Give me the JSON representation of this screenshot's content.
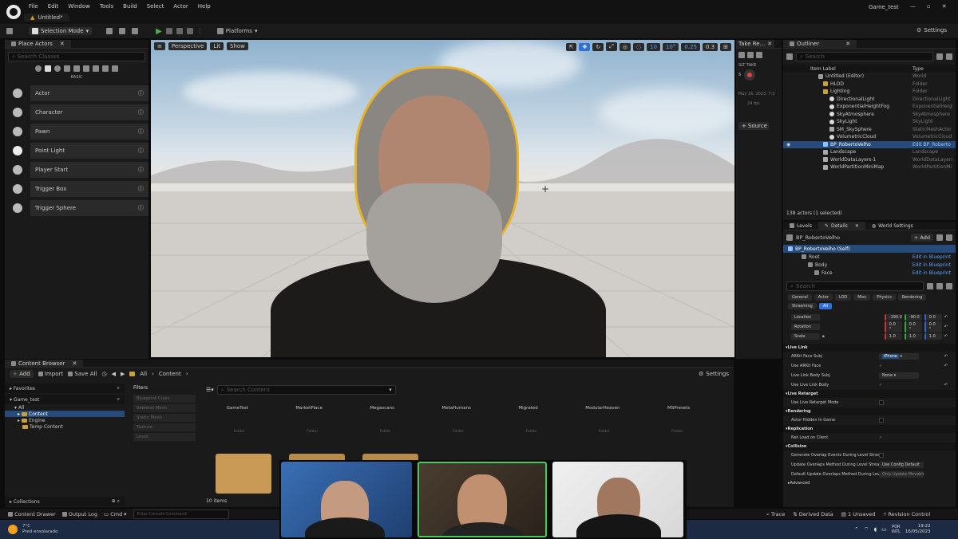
{
  "menubar": {
    "items": [
      "File",
      "Edit",
      "Window",
      "Tools",
      "Build",
      "Select",
      "Actor",
      "Help"
    ],
    "project": "Game_test",
    "level_tab": "Untitled*"
  },
  "toolbar": {
    "selection_mode": "Selection Mode",
    "platforms": "Platforms",
    "settings": "Settings"
  },
  "place_actors": {
    "tab": "Place Actors",
    "search_placeholder": "Search Classes",
    "category": "BASIC",
    "items": [
      "Actor",
      "Character",
      "Pawn",
      "Point Light",
      "Player Start",
      "Trigger Box",
      "Trigger Sphere"
    ]
  },
  "viewport": {
    "perspective": "Perspective",
    "lit": "Lit",
    "show": "Show",
    "grid_snap": "10",
    "rot_snap": "10°",
    "scale_snap": "0.25",
    "cam_speed": "0.3"
  },
  "take_recorder": {
    "tab": "Take Re...",
    "slate_label": "SLT TAKE",
    "date": "May 16, 2023, 7:3",
    "fps": "24 fps",
    "source_btn": "Source"
  },
  "outliner": {
    "tab": "Outliner",
    "search_placeholder": "Search",
    "col_label": "Item Label",
    "col_type": "Type",
    "rows": [
      {
        "label": "Untitled (Editor)",
        "type": "World",
        "indent": 0
      },
      {
        "label": "HLOD",
        "type": "Folder",
        "indent": 1
      },
      {
        "label": "Lighting",
        "type": "Folder",
        "indent": 1
      },
      {
        "label": "DirectionalLight",
        "type": "DirectionalLight",
        "indent": 2
      },
      {
        "label": "ExponentialHeightFog",
        "type": "ExponentialHeightFog",
        "indent": 2
      },
      {
        "label": "SkyAtmosphere",
        "type": "SkyAtmosphere",
        "indent": 2
      },
      {
        "label": "SkyLight",
        "type": "SkyLight",
        "indent": 2
      },
      {
        "label": "SM_SkySphere",
        "type": "StaticMeshActor",
        "indent": 2
      },
      {
        "label": "VolumetricCloud",
        "type": "VolumetricCloud",
        "indent": 2
      },
      {
        "label": "BP_RobertoVelho",
        "type": "Edit BP_Roberto",
        "indent": 1
      },
      {
        "label": "Landscape",
        "type": "Landscape",
        "indent": 1
      },
      {
        "label": "WorldDataLayers-1",
        "type": "WorldDataLayers",
        "indent": 1
      },
      {
        "label": "WorldPartitionMiniMap",
        "type": "WorldPartitionMi",
        "indent": 1
      }
    ],
    "status": "138 actors (1 selected)"
  },
  "details": {
    "tabs": [
      "Levels",
      "Details",
      "World Settings"
    ],
    "actor_name": "BP_RobertoVelho",
    "add_btn": "Add",
    "components": [
      {
        "name": "BP_RobertoVelho (Self)",
        "link": ""
      },
      {
        "name": "Root",
        "link": "Edit in Blueprint"
      },
      {
        "name": "Body",
        "link": "Edit in Blueprint"
      },
      {
        "name": "Face",
        "link": "Edit in Blueprint"
      }
    ],
    "search_placeholder": "Search",
    "filter_tabs": [
      "General",
      "Actor",
      "LOD",
      "Misc",
      "Physics",
      "Rendering",
      "Streaming",
      "All"
    ],
    "transform": [
      {
        "label": "Location",
        "values": [
          "-190.0",
          "-90.0",
          "0.0"
        ]
      },
      {
        "label": "Rotation",
        "values": [
          "0.0 °",
          "0.0 °",
          "0.0 °"
        ]
      },
      {
        "label": "Scale",
        "values": [
          "1.0",
          "1.0",
          "1.0"
        ]
      }
    ],
    "sections": [
      {
        "title": "Live Link",
        "props": [
          {
            "label": "ARKit Face Subj",
            "value": "iPhone"
          },
          {
            "label": "Use ARKit Face",
            "value": "✓"
          },
          {
            "label": "Live Link Body Subj",
            "value": "None"
          },
          {
            "label": "Use Live Link Body",
            "value": "✓"
          }
        ]
      },
      {
        "title": "Live Retarget",
        "props": [
          {
            "label": "Use Live Retarget Mode",
            "value": ""
          }
        ]
      },
      {
        "title": "Rendering",
        "props": [
          {
            "label": "Actor Hidden In Game",
            "value": ""
          }
        ]
      },
      {
        "title": "Replication",
        "props": [
          {
            "label": "Net Load on Client",
            "value": "✓"
          }
        ]
      },
      {
        "title": "Collision",
        "props": [
          {
            "label": "Generate Overlap Events During Level Streami",
            "value": ""
          },
          {
            "label": "Update Overlaps Method During Level Streami",
            "value": "Use Config Default"
          },
          {
            "label": "Default Update Overlaps Method During Level",
            "value": "Only Update Movable"
          }
        ]
      },
      {
        "title": "Advanced",
        "props": []
      }
    ]
  },
  "content_browser": {
    "tab": "Content Browser",
    "add_btn": "Add",
    "import_btn": "Import",
    "save_all_btn": "Save All",
    "path": [
      "All",
      "Content"
    ],
    "settings": "Settings",
    "favorites": "Favorites",
    "project_root": "Game_test",
    "tree": [
      "All",
      "Content",
      "Engine",
      "Temp Content"
    ],
    "filters_label": "Filters",
    "filter_items": [
      "Blueprint Class",
      "Skeletal Mesh",
      "Static Mesh",
      "Texture",
      "Level"
    ],
    "search_placeholder": "Search Content",
    "folders": [
      "GameTest",
      "MarketPlace",
      "Megascans",
      "MetaHumans",
      "Migrated",
      "ModularHeaven",
      "MSPresets"
    ],
    "folder_type": "Folder",
    "item_count": "10 items",
    "collections": "Collections"
  },
  "status_bar": {
    "content_drawer": "Content Drawer",
    "output_log": "Output Log",
    "cmd": "Cmd",
    "console_placeholder": "Enter Console Command",
    "trace": "Trace",
    "derived_data": "Derived Data",
    "unsaved": "1 Unsaved",
    "revision_control": "Revision Control"
  },
  "taskbar": {
    "weather_temp": "7°C",
    "weather_desc": "Pred ensolarado",
    "lang": "POR",
    "lang2": "INTL",
    "time": "19:22",
    "date": "16/05/2023"
  },
  "colors": {
    "accent_blue": "#2f6fd6",
    "play_green": "#4caf50",
    "cam_active_border": "#3ccf5a"
  }
}
